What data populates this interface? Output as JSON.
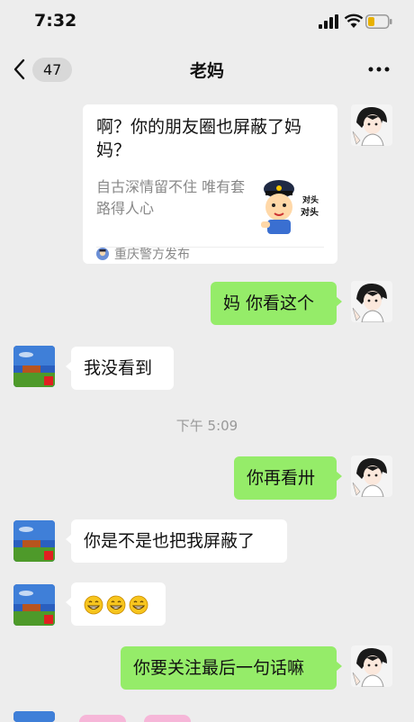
{
  "status": {
    "time": "7:32"
  },
  "nav": {
    "back_count": "47",
    "title": "老妈"
  },
  "card": {
    "title": "啊？你的朋友圈也屏蔽了妈妈？",
    "desc": "自古深情留不住 唯有套路得人心",
    "sticker_text_1": "对头",
    "sticker_text_2": "对头",
    "source": "重庆警方发布"
  },
  "messages": [
    {
      "side": "right",
      "text": "妈 你看这个"
    },
    {
      "side": "left",
      "text": "我没看到"
    },
    {
      "side": "right",
      "text": "你再看卅"
    },
    {
      "side": "left",
      "text": "你是不是也把我屏蔽了"
    },
    {
      "side": "left",
      "emoji": [
        "grin-emoji",
        "grin-emoji",
        "grin-emoji"
      ]
    },
    {
      "side": "right",
      "text": "你要关注最后一句话嘛"
    }
  ],
  "timestamp": "下午 5:09",
  "colors": {
    "bg": "#ededed",
    "mine": "#95ec69",
    "theirs": "#ffffff"
  }
}
